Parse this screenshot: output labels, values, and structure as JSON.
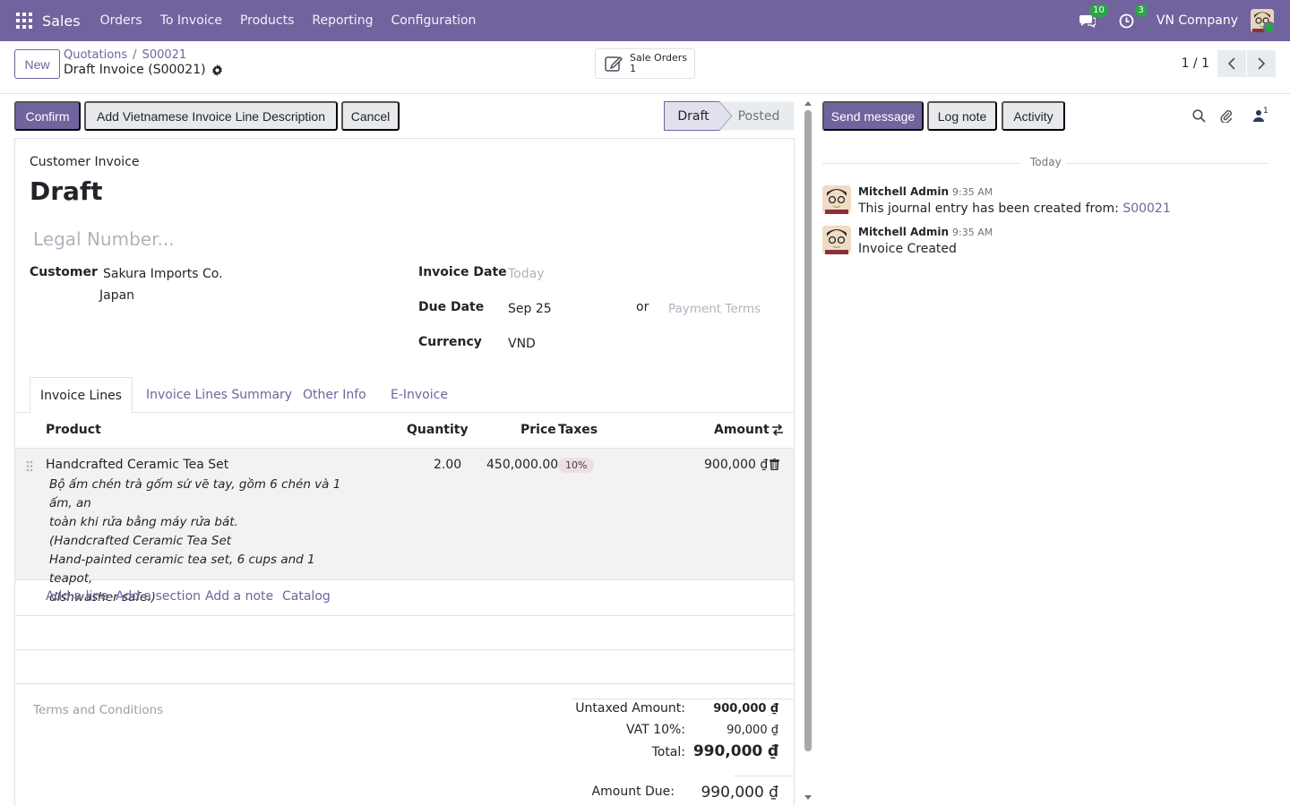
{
  "navbar": {
    "brand": "Sales",
    "menu": [
      "Orders",
      "To Invoice",
      "Products",
      "Reporting",
      "Configuration"
    ],
    "messages_count": "10",
    "activities_count": "3",
    "company": "VN Company"
  },
  "control": {
    "new_label": "New",
    "breadcrumb_parent": "Quotations",
    "breadcrumb_order": "S00021",
    "record_title": "Draft Invoice (S00021)",
    "smart_button_label": "Sale Orders",
    "smart_button_count": "1",
    "pager": "1 / 1"
  },
  "actions": {
    "confirm": "Confirm",
    "add_vn_desc": "Add Vietnamese Invoice Line Description",
    "cancel": "Cancel"
  },
  "stages": [
    "Draft",
    "Posted"
  ],
  "form": {
    "type_label": "Customer Invoice",
    "state": "Draft",
    "legal_number_placeholder": "Legal Number...",
    "customer_label": "Customer",
    "customer_name": "Sakura Imports Co.",
    "customer_country": "Japan",
    "invoice_date_label": "Invoice Date",
    "invoice_date_placeholder": "Today",
    "due_date_label": "Due Date",
    "due_date_value": "Sep 25",
    "or_label": "or",
    "payment_terms_placeholder": "Payment Terms",
    "currency_label": "Currency",
    "currency_value": "VND"
  },
  "tabs": [
    "Invoice Lines",
    "Invoice Lines Summary",
    "Other Info",
    "E-Invoice"
  ],
  "table": {
    "headers": {
      "product": "Product",
      "quantity": "Quantity",
      "price": "Price",
      "taxes": "Taxes",
      "amount": "Amount"
    },
    "line": {
      "product": "Handcrafted Ceramic Tea Set",
      "description": [
        "Bộ ấm chén trà gốm sứ vẽ tay, gồm 6 chén và 1 ấm, an",
        "toàn khi rửa bằng máy rửa bát.",
        "(Handcrafted Ceramic Tea Set",
        "Hand-painted ceramic tea set, 6 cups and 1 teapot,",
        "dishwasher safe.)"
      ],
      "quantity": "2.00",
      "price": "450,000.00",
      "tax": "10%",
      "amount": "900,000 ₫"
    },
    "add_links": [
      "Add a line",
      "Add a section",
      "Add a note",
      "Catalog"
    ]
  },
  "footer": {
    "terms_placeholder": "Terms and Conditions",
    "untaxed_label": "Untaxed Amount:",
    "untaxed_value": "900,000 ₫",
    "vat_label": "VAT 10%:",
    "vat_value": "90,000 ₫",
    "total_label": "Total:",
    "total_value": "990,000 ₫",
    "amount_due_label": "Amount Due:",
    "amount_due_value": "990,000 ₫"
  },
  "chatter": {
    "send_message": "Send message",
    "log_note": "Log note",
    "activity": "Activity",
    "followers_count": "1",
    "date_separator": "Today",
    "messages": [
      {
        "author": "Mitchell Admin",
        "time": "9:35 AM",
        "text": "This journal entry has been created from: ",
        "link": "S00021"
      },
      {
        "author": "Mitchell Admin",
        "time": "9:35 AM",
        "text": "Invoice Created"
      }
    ]
  },
  "colors": {
    "brand": "#71639e",
    "accent_green": "#28a745"
  }
}
